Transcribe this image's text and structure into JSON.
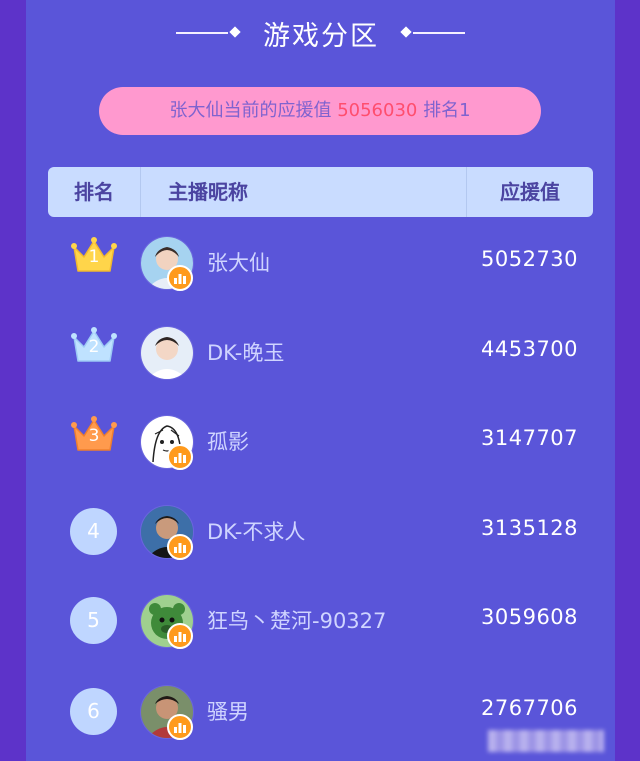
{
  "header": {
    "title": "游戏分区"
  },
  "banner": {
    "prefix": "张大仙当前的应援值",
    "value": "5056030",
    "rank_text": "排名1"
  },
  "table": {
    "columns": {
      "rank": "排名",
      "name": "主播昵称",
      "value": "应援值"
    },
    "rows": [
      {
        "rank": "1",
        "name": "张大仙",
        "value": "5052730",
        "badge": "gold-crown"
      },
      {
        "rank": "2",
        "name": "DK-晚玉",
        "value": "4453700",
        "badge": "blue-crown"
      },
      {
        "rank": "3",
        "name": "孤影",
        "value": "3147707",
        "badge": "orange-crown"
      },
      {
        "rank": "4",
        "name": "DK-不求人",
        "value": "3135128",
        "badge": "circle"
      },
      {
        "rank": "5",
        "name": "狂鸟丶楚河-90327",
        "value": "3059608",
        "badge": "circle"
      },
      {
        "rank": "6",
        "name": "骚男",
        "value": "2767706",
        "badge": "circle"
      }
    ]
  },
  "colors": {
    "background": "#5a55d9",
    "banner": "#ff99cf",
    "highlight": "#ff4e6e",
    "header_bg": "#c9dcff",
    "gold": "#ffd54a",
    "silver_blue": "#bfe2ff",
    "bronze": "#ff9a4d"
  }
}
